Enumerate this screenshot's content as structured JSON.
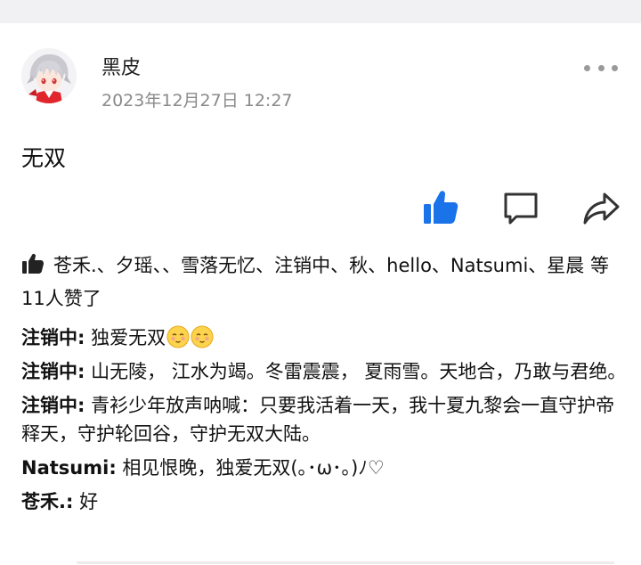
{
  "post": {
    "username": "黑皮",
    "timestamp": "2023年12月27日 12:27",
    "content": "无双"
  },
  "likes": {
    "names": "苍禾.、夕瑶、、雪落无忆、注销中、秋、hello、Natsumi、星晨",
    "summary": " 等11人赞了"
  },
  "comments": [
    {
      "author": "注销中:",
      "text": " 独爱无双",
      "emoji_count": 2
    },
    {
      "author": "注销中:",
      "text": " 山无陵， 江水为竭。冬雷震震， 夏雨雪。天地合，乃敢与君绝。"
    },
    {
      "author": "注销中:",
      "text": " 青衫少年放声呐喊：只要我活着一天，我十夏九黎会一直守护帝释天，守护轮回谷，守护无双大陆。"
    },
    {
      "author": "Natsumi:",
      "text": " 相见恨晚，独爱无双(｡･ω･｡)ﾉ♡"
    },
    {
      "author": "苍禾.:",
      "text": " 好"
    }
  ],
  "colors": {
    "like_active": "#1a73e8",
    "text_secondary": "#8a8a8a",
    "background_band": "#f1f1f3"
  },
  "icons": {
    "like": "thumbs-up-icon",
    "comment": "comment-bubble-icon",
    "share": "share-arrow-icon",
    "more": "more-dots-icon"
  }
}
